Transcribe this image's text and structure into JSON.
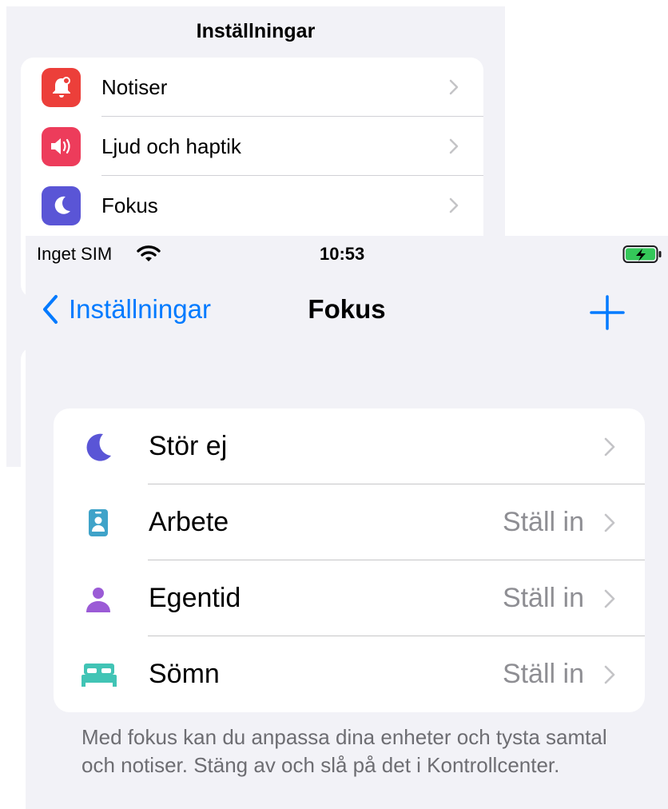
{
  "background_screen": {
    "title": "Inställningar",
    "items": [
      {
        "label": "Notiser",
        "icon": "bell-icon",
        "color": "#ec3f3a"
      },
      {
        "label": "Ljud och haptik",
        "icon": "speaker-icon",
        "color": "#ed3c5b"
      },
      {
        "label": "Fokus",
        "icon": "moon-icon",
        "color": "#5a55d6"
      }
    ]
  },
  "status_bar": {
    "carrier": "Inget SIM",
    "time": "10:53",
    "battery_color": "#34c759"
  },
  "nav": {
    "back_label": "Inställningar",
    "title": "Fokus",
    "accent": "#007aff"
  },
  "focus_modes": [
    {
      "label": "Stör ej",
      "value": "",
      "icon": "moon-icon",
      "color": "#5a55d6"
    },
    {
      "label": "Arbete",
      "value": "Ställ in",
      "icon": "id-badge-icon",
      "color": "#3fa3c9"
    },
    {
      "label": "Egentid",
      "value": "Ställ in",
      "icon": "person-icon",
      "color": "#9b5bd6"
    },
    {
      "label": "Sömn",
      "value": "Ställ in",
      "icon": "bed-icon",
      "color": "#41c4b5"
    }
  ],
  "footer": "Med fokus kan du anpassa dina enheter och tysta samtal och notiser. Stäng av och slå på det i Kontrollcenter."
}
